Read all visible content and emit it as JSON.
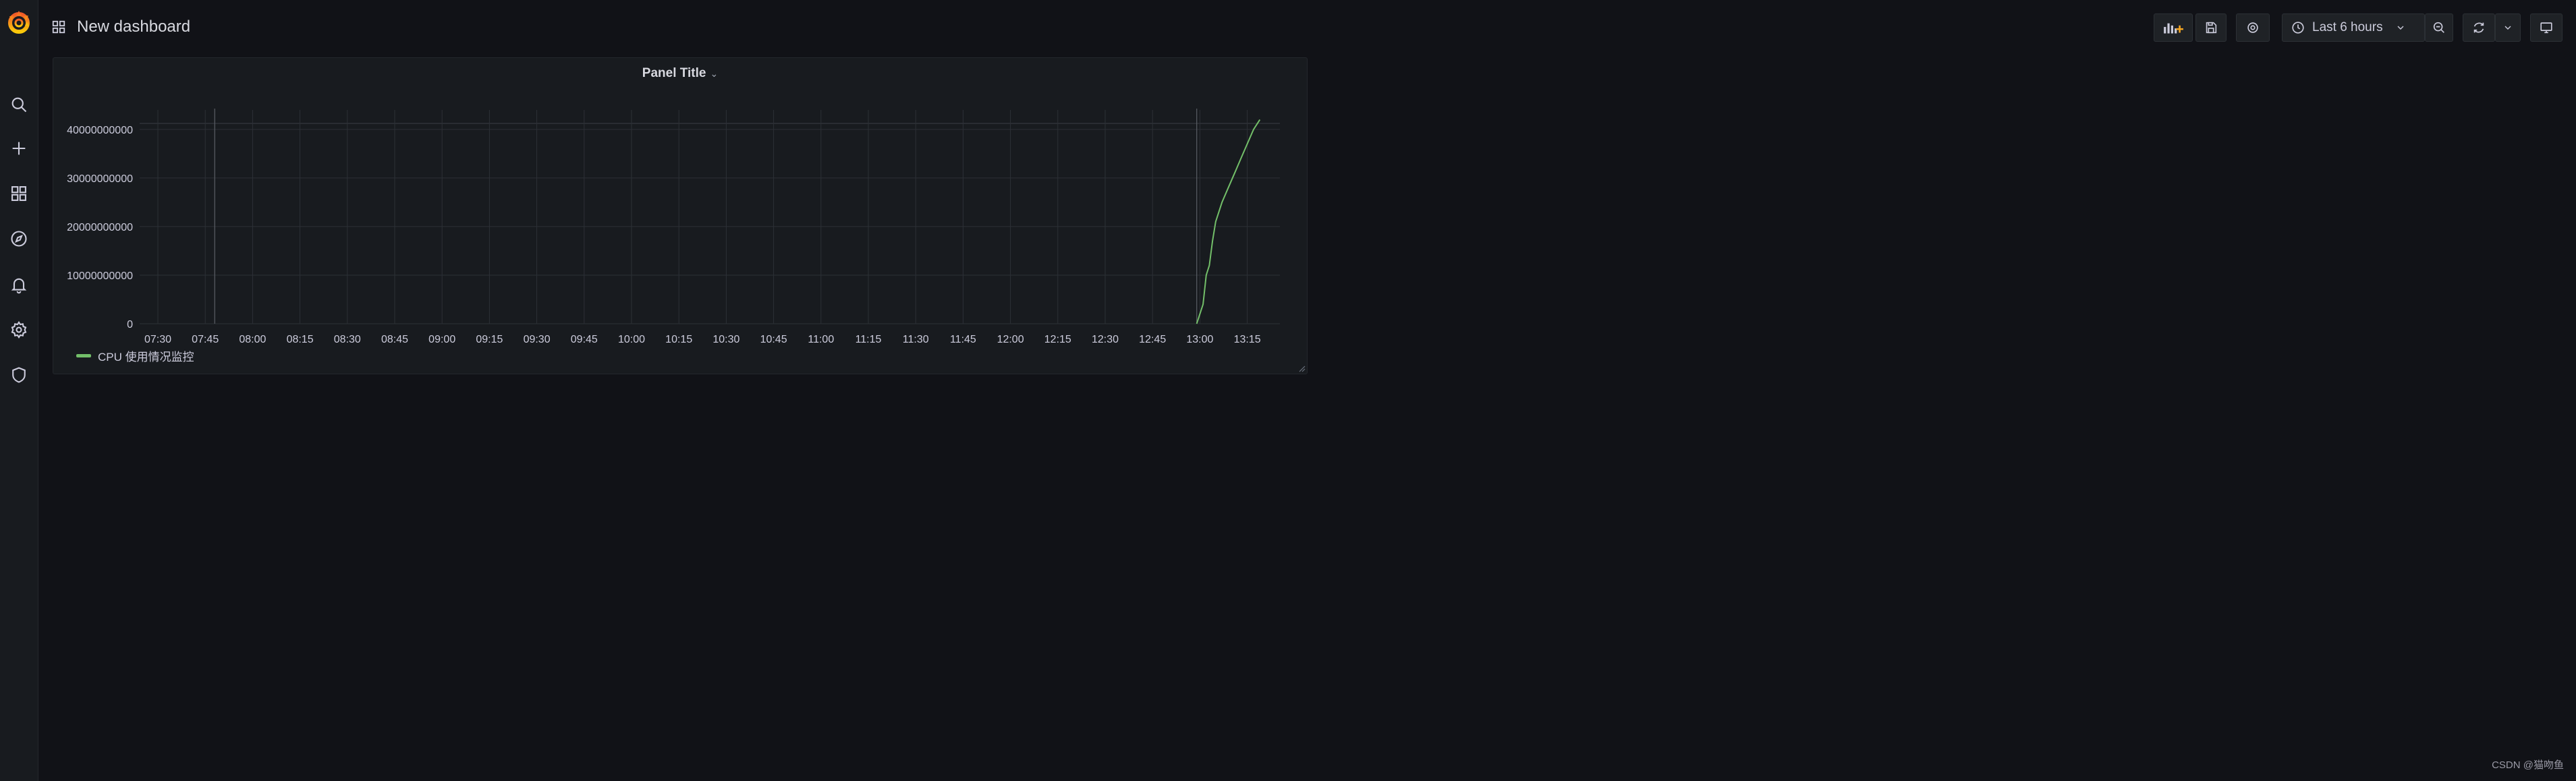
{
  "app": {
    "logo": "grafana-logo"
  },
  "sidebar": {
    "items": [
      {
        "name": "search",
        "icon": "search-icon"
      },
      {
        "name": "create",
        "icon": "plus-icon"
      },
      {
        "name": "dashboards",
        "icon": "grid-icon"
      },
      {
        "name": "explore",
        "icon": "compass-icon"
      },
      {
        "name": "alerting",
        "icon": "bell-icon"
      },
      {
        "name": "configuration",
        "icon": "gear-icon"
      },
      {
        "name": "server-admin",
        "icon": "shield-icon"
      }
    ]
  },
  "header": {
    "title": "New dashboard",
    "time_range_label": "Last 6 hours",
    "buttons": [
      "add-panel",
      "save-dashboard",
      "dashboard-settings",
      "time-picker",
      "zoom-out",
      "refresh",
      "refresh-interval",
      "cycle-view-mode"
    ]
  },
  "panel": {
    "title": "Panel Title",
    "legend": [
      {
        "name": "CPU 使用情况监控",
        "color": "#73bf69"
      }
    ]
  },
  "colors": {
    "background": "#111217",
    "panel_bg": "#181b1f",
    "series": "#73bf69",
    "grid": "#2c3036"
  },
  "chart_data": {
    "type": "line",
    "xlabel": "",
    "ylabel": "",
    "x_ticks": [
      "07:30",
      "07:45",
      "08:00",
      "08:15",
      "08:30",
      "08:45",
      "09:00",
      "09:15",
      "09:30",
      "09:45",
      "10:00",
      "10:15",
      "10:30",
      "10:45",
      "11:00",
      "11:15",
      "11:30",
      "11:45",
      "12:00",
      "12:15",
      "12:30",
      "12:45",
      "13:00",
      "13:15"
    ],
    "y_ticks": [
      "0",
      "10000000000",
      "20000000000",
      "30000000000",
      "40000000000"
    ],
    "ylim": [
      0,
      44000000000
    ],
    "grid": true,
    "legend_position": "bottom-left",
    "series": [
      {
        "name": "CPU 使用情况监控",
        "color": "#73bf69",
        "points": [
          [
            "12:59",
            0
          ],
          [
            "13:01",
            4000000000
          ],
          [
            "13:02",
            10000000000
          ],
          [
            "13:03",
            12000000000
          ],
          [
            "13:04",
            17000000000
          ],
          [
            "13:05",
            21000000000
          ],
          [
            "13:07",
            25000000000
          ],
          [
            "13:09",
            28000000000
          ],
          [
            "13:11",
            31000000000
          ],
          [
            "13:13",
            34000000000
          ],
          [
            "13:15",
            37000000000
          ],
          [
            "13:17",
            40000000000
          ],
          [
            "13:19",
            42000000000
          ]
        ]
      }
    ],
    "annotations": [
      {
        "time": "07:48",
        "kind": "vertical-marker"
      },
      {
        "time": "12:59",
        "kind": "vertical-marker"
      }
    ]
  },
  "footer": {
    "watermark": "CSDN @猫吻鱼"
  }
}
